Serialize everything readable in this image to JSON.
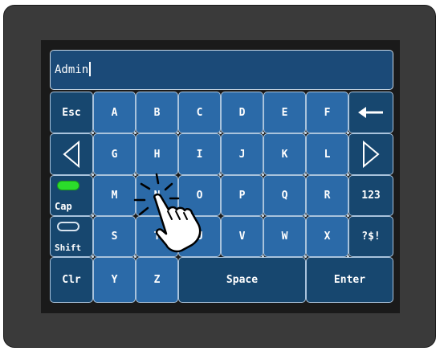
{
  "display": {
    "value": "Admin"
  },
  "keys": {
    "esc": "Esc",
    "a": "A",
    "b": "B",
    "c": "C",
    "d": "D",
    "e": "E",
    "f": "F",
    "g": "G",
    "h": "H",
    "i": "I",
    "j": "J",
    "k": "K",
    "l": "L",
    "m": "M",
    "n": "N",
    "o": "O",
    "p": "P",
    "q": "Q",
    "r": "R",
    "num": "123",
    "cap": "Cap",
    "s": "S",
    "t": "T",
    "u": "U",
    "v": "V",
    "w": "W",
    "x": "X",
    "sym": "?$!",
    "shift": "Shift",
    "clr": "Clr",
    "y": "Y",
    "z": "Z",
    "space": "Space",
    "enter": "Enter"
  },
  "colors": {
    "key_fill": "#2b6aa8",
    "key_dark": "#17476f",
    "cap_indicator": "#2bdc2b"
  },
  "icons": {
    "backspace": "left-arrow",
    "cursor_left": "triangle-left",
    "cursor_right": "triangle-right",
    "pointer": "hand-tap"
  }
}
